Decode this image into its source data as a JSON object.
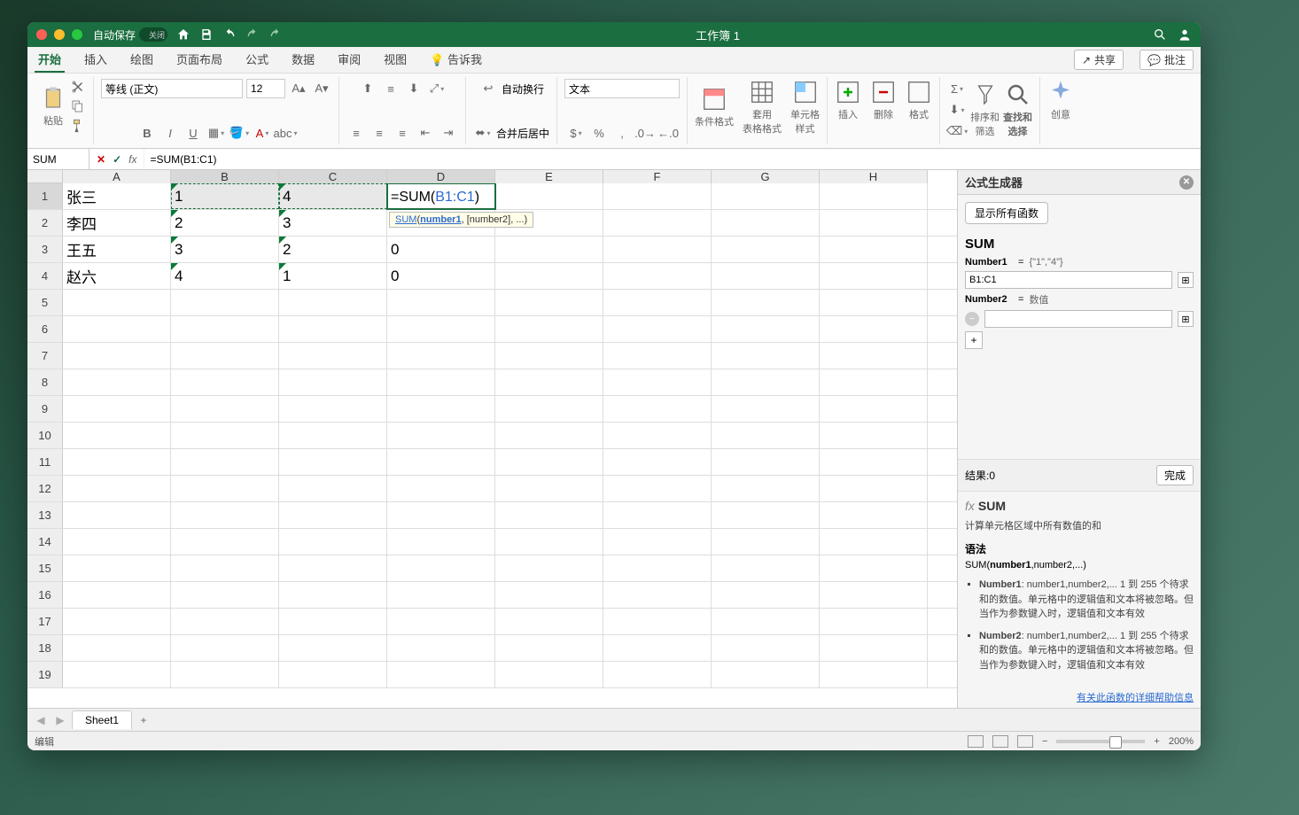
{
  "titlebar": {
    "autosave_label": "自动保存",
    "autosave_state": "关闭",
    "title": "工作簿 1"
  },
  "tabs": {
    "items": [
      "开始",
      "插入",
      "绘图",
      "页面布局",
      "公式",
      "数据",
      "审阅",
      "视图"
    ],
    "tellme_label": "告诉我",
    "share_label": "共享",
    "comment_label": "批注"
  },
  "ribbon": {
    "paste_label": "粘贴",
    "font_name": "等线 (正文)",
    "font_size": "12",
    "wrap_label": "自动换行",
    "merge_label": "合并后居中",
    "number_format": "文本",
    "cond_format": "条件格式",
    "table_format": "套用\n表格格式",
    "cell_styles": "单元格\n样式",
    "insert_label": "插入",
    "delete_label": "删除",
    "format_label": "格式",
    "sort_filter": "排序和\n筛选",
    "find_select": "查找和\n选择",
    "ideas": "创意"
  },
  "formula_bar": {
    "name_box": "SUM",
    "formula": "=SUM(B1:C1)"
  },
  "columns": [
    "A",
    "B",
    "C",
    "D",
    "E",
    "F",
    "G",
    "H"
  ],
  "grid": {
    "rows": [
      {
        "n": "1",
        "cells": [
          "张三",
          "1",
          "4",
          "=SUM(B1:C1)",
          "",
          "",
          "",
          ""
        ]
      },
      {
        "n": "2",
        "cells": [
          "李四",
          "2",
          "3",
          "0",
          "",
          "",
          "",
          ""
        ]
      },
      {
        "n": "3",
        "cells": [
          "王五",
          "3",
          "2",
          "0",
          "",
          "",
          "",
          ""
        ]
      },
      {
        "n": "4",
        "cells": [
          "赵六",
          "4",
          "1",
          "0",
          "",
          "",
          "",
          ""
        ]
      }
    ],
    "empty_rows": [
      "5",
      "6",
      "7",
      "8",
      "9",
      "10",
      "11",
      "12",
      "13",
      "14",
      "15",
      "16",
      "17",
      "18",
      "19"
    ]
  },
  "tooltip": {
    "fn": "SUM",
    "arg1": "number1",
    "rest": ", [number2], ...)"
  },
  "panel": {
    "title": "公式生成器",
    "show_all": "显示所有函数",
    "fn": "SUM",
    "arg1_label": "Number1",
    "arg1_preview": "{\"1\",\"4\"}",
    "arg1_value": "B1:C1",
    "arg2_label": "Number2",
    "arg2_hint": "数值",
    "result_label": "结果: ",
    "result_value": "0",
    "done": "完成",
    "help_fn": "SUM",
    "help_desc": "计算单元格区域中所有数值的和",
    "syntax_label": "语法",
    "syntax": "SUM(number1,number2,...)",
    "syntax_bold": "number1",
    "arg_explain": [
      {
        "name": "Number1",
        "text": ": number1,number2,...   1 到 255 个待求和的数值。单元格中的逻辑值和文本将被忽略。但当作为参数键入时，逻辑值和文本有效"
      },
      {
        "name": "Number2",
        "text": ": number1,number2,...   1 到 255 个待求和的数值。单元格中的逻辑值和文本将被忽略。但当作为参数键入时，逻辑值和文本有效"
      }
    ],
    "more_help": "有关此函数的详细帮助信息"
  },
  "sheet_tabs": {
    "sheet1": "Sheet1"
  },
  "statusbar": {
    "mode": "编辑",
    "zoom": "200%"
  }
}
